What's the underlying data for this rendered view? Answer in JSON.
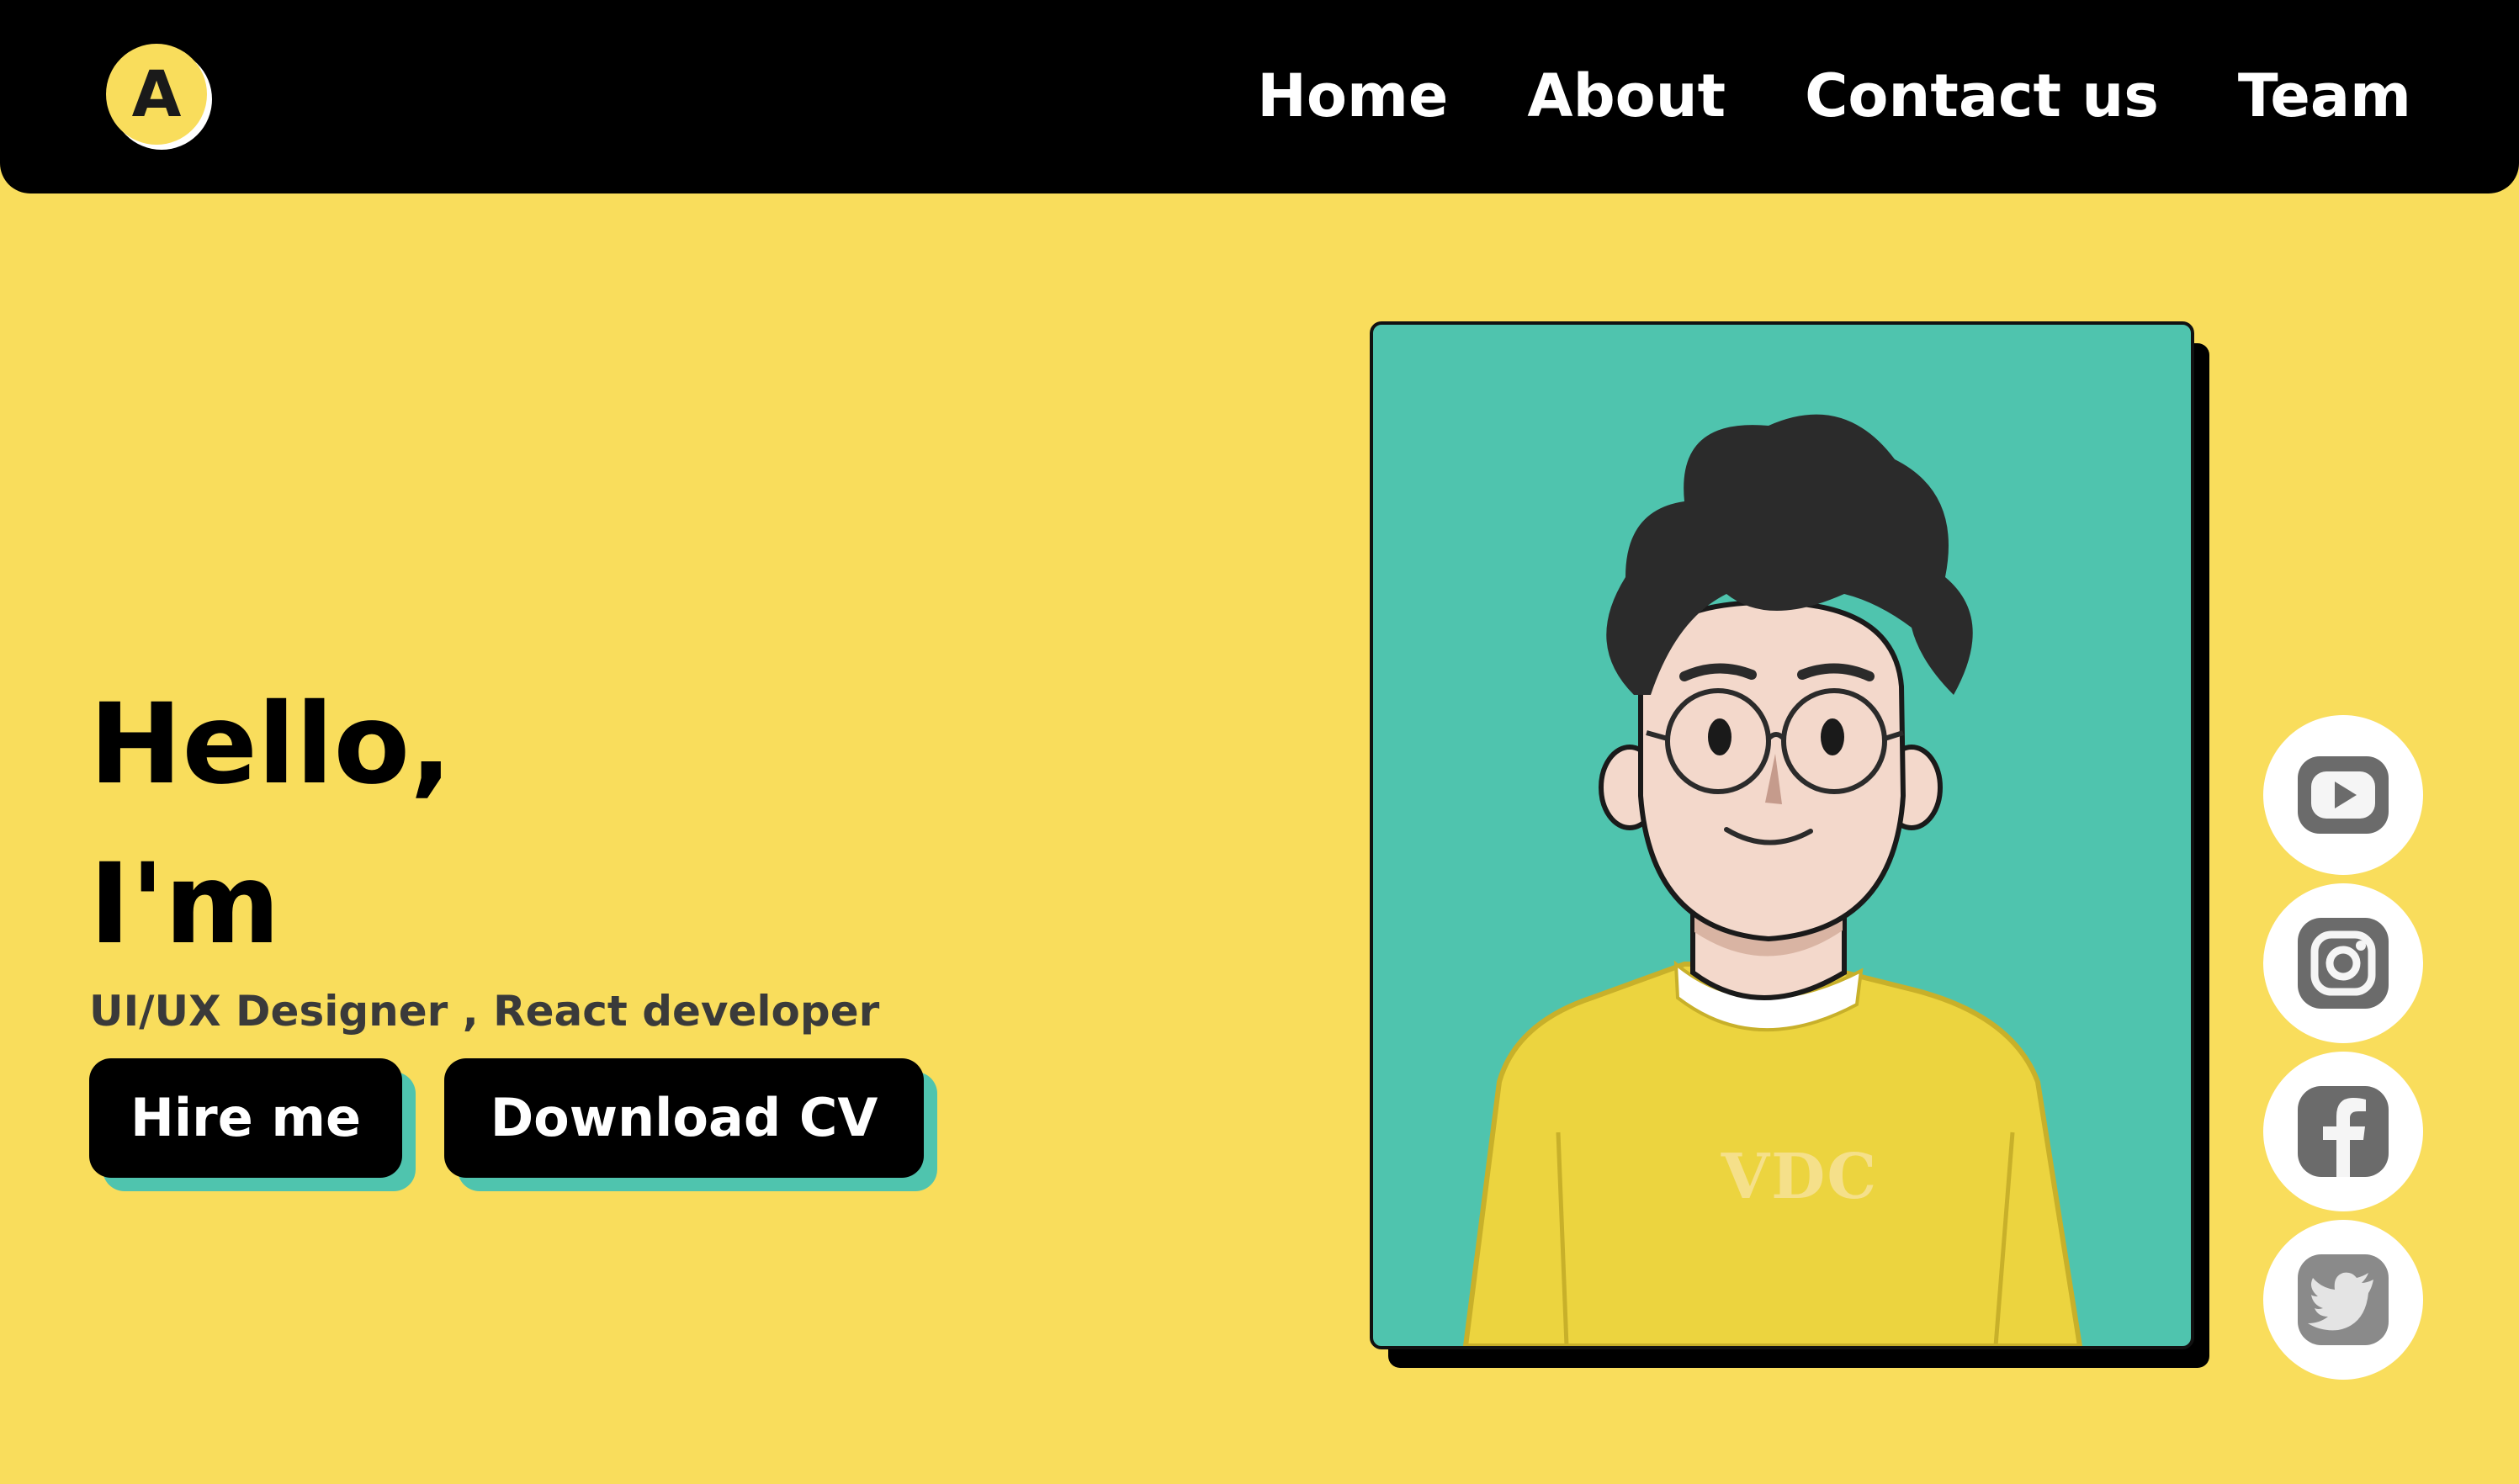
{
  "brand": {
    "logo_letter": "A",
    "logo_color": "#f9dd5c"
  },
  "nav": {
    "links": [
      "Home",
      "About",
      "Contact us",
      "Team"
    ]
  },
  "hero": {
    "greeting_line1": "Hello,",
    "greeting_line2": "I'm",
    "subtitle": "UI/UX Designer , React developer",
    "buttons": {
      "hire": "Hire me",
      "download": "Download CV"
    }
  },
  "portrait": {
    "shirt_text": "VDC",
    "background_color": "#4fc4ae",
    "shirt_color": "#ecd43f"
  },
  "socials": [
    "youtube-icon",
    "instagram-icon",
    "facebook-icon",
    "twitter-icon"
  ],
  "colors": {
    "page_background": "#f9dd5c",
    "navbar": "#000000",
    "button_shadow": "#4fc4ae"
  }
}
